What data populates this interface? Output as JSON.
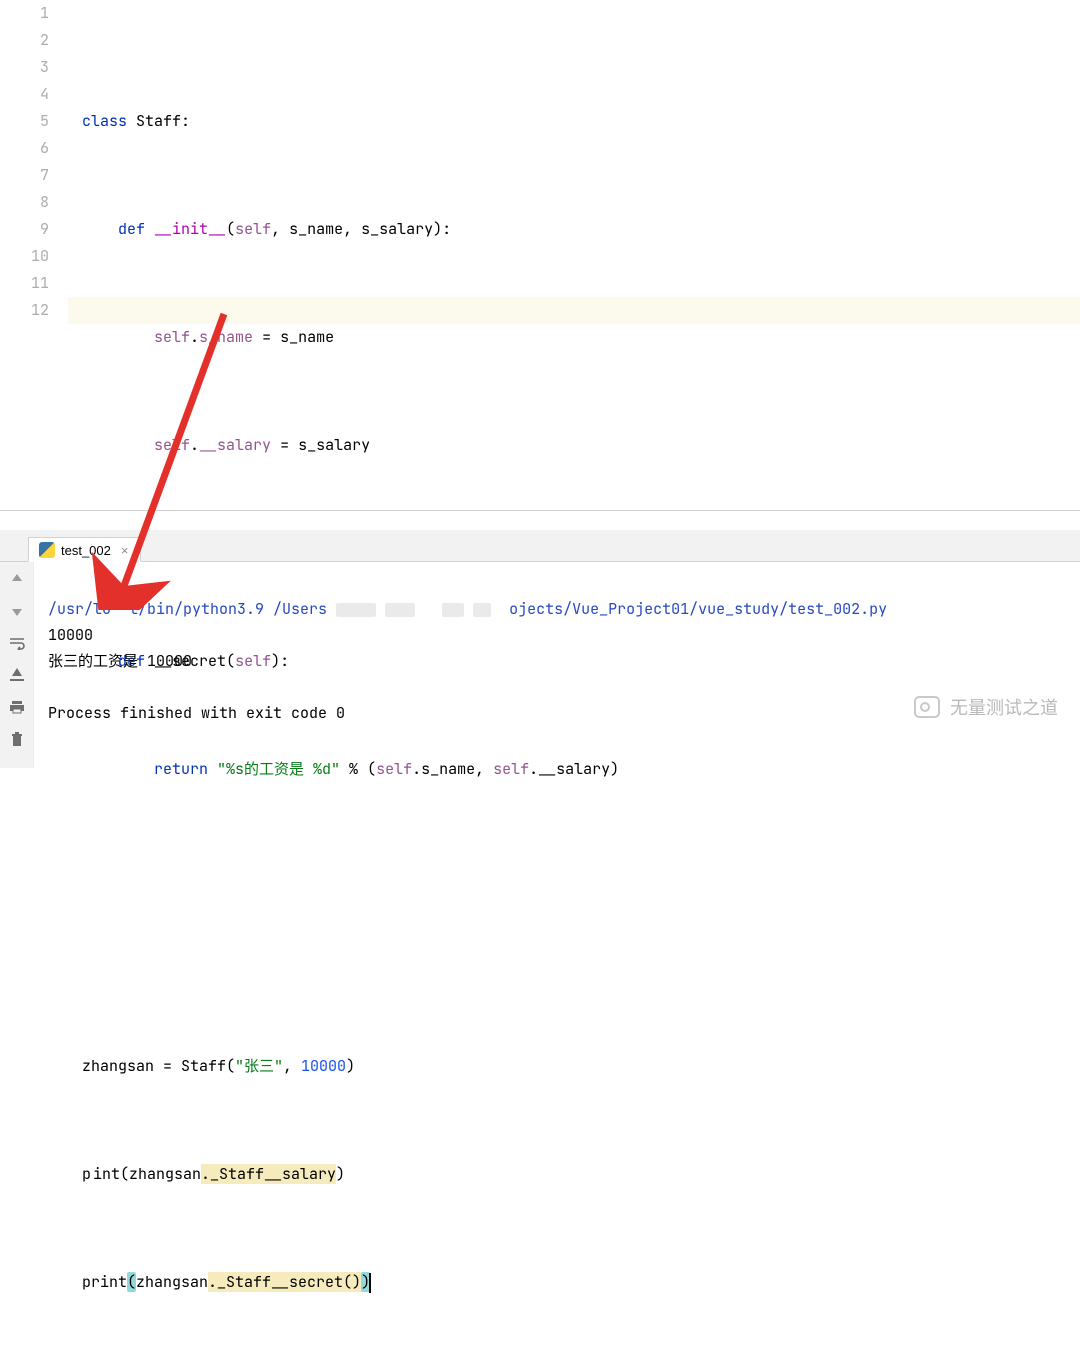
{
  "editor": {
    "line_numbers": [
      "1",
      "2",
      "3",
      "4",
      "5",
      "6",
      "7",
      "8",
      "9",
      "10",
      "11",
      "12"
    ],
    "lines": {
      "l1": {
        "kw1": "class ",
        "cls": "Staff",
        "rest": ":"
      },
      "l2": {
        "indent": "    ",
        "kw": "def ",
        "fn": "__init__",
        "sig_open": "(",
        "self": "self",
        "rest": ", s_name, s_salary):"
      },
      "l3": {
        "indent": "        ",
        "self": "self",
        "dot": ".",
        "attr": "s_name",
        "eq": " = ",
        "rhs": "s_name"
      },
      "l4": {
        "indent": "        ",
        "self": "self",
        "dot": ".",
        "attr": "__salary",
        "eq": " = ",
        "rhs": "s_salary"
      },
      "l5": {
        "blank": ""
      },
      "l6": {
        "indent": "    ",
        "kw": "def ",
        "fn": "__secret",
        "sig_open": "(",
        "self": "self",
        "rest": "):"
      },
      "l7": {
        "indent": "        ",
        "kw": "return ",
        "str": "\"%s的工资是 %d\"",
        "mid": " % (",
        "self1": "self",
        "dot1": ".s_name, ",
        "self2": "self",
        "dot2": ".__salary)"
      },
      "l8": {
        "blank": ""
      },
      "l9": {
        "blank": ""
      },
      "l10": {
        "lead": "zhangsan = Staff(",
        "str": "\"张三\"",
        "comma": ", ",
        "num": "10000",
        "close": ")"
      },
      "l11": {
        "p": "p",
        "rint": "int(zhangsan",
        "warn": "._Staff__salary",
        "close": ")"
      },
      "l12": {
        "pr": "print",
        "open": "(",
        "mid": "zhangsan",
        "warn": "._Staff__secret()",
        "close": ")"
      }
    }
  },
  "run": {
    "tab_label": "test_002",
    "path_prefix": "/usr/lo",
    "path_mid1": "l/bin/python3.9 /Users",
    "path_mid2": "ojects/Vue_Project01/vue_study/test_002.py",
    "out1": "10000",
    "out2": "张三的工资是 10000",
    "exit": "Process finished with exit code 0"
  },
  "watermark": {
    "text": "无量测试之道"
  }
}
